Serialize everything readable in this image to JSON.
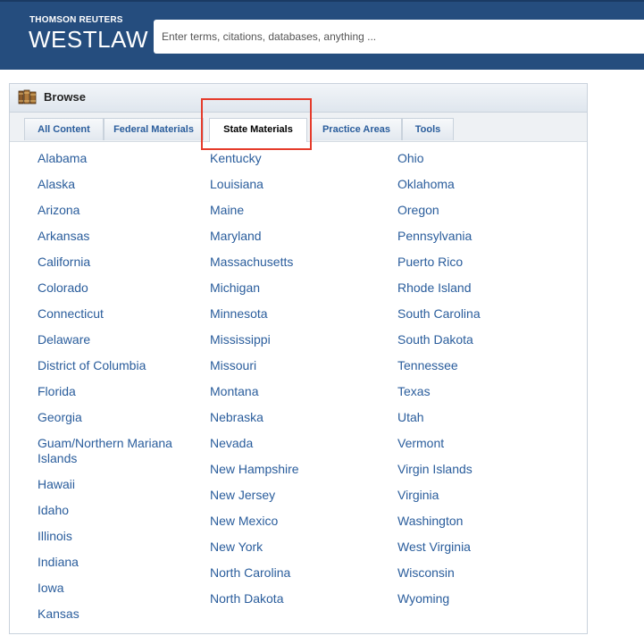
{
  "header": {
    "brand_small": "THOMSON REUTERS",
    "brand_big": "WESTLAW",
    "search_placeholder": "Enter terms, citations, databases, anything ...",
    "background_color": "#254d7e"
  },
  "browse": {
    "title": "Browse",
    "icon": "books-icon",
    "tabs": [
      {
        "label": "All Content",
        "active": false
      },
      {
        "label": "Federal Materials",
        "active": false
      },
      {
        "label": "State Materials",
        "active": true
      },
      {
        "label": "Practice Areas",
        "active": false
      },
      {
        "label": "Tools",
        "active": false
      }
    ],
    "columns": [
      [
        "Alabama",
        "Alaska",
        "Arizona",
        "Arkansas",
        "California",
        "Colorado",
        "Connecticut",
        "Delaware",
        "District of Columbia",
        "Florida",
        "Georgia",
        "Guam/Northern Mariana Islands",
        "Hawaii",
        "Idaho",
        "Illinois",
        "Indiana",
        "Iowa",
        "Kansas"
      ],
      [
        "Kentucky",
        "Louisiana",
        "Maine",
        "Maryland",
        "Massachusetts",
        "Michigan",
        "Minnesota",
        "Mississippi",
        "Missouri",
        "Montana",
        "Nebraska",
        "Nevada",
        "New Hampshire",
        "New Jersey",
        "New Mexico",
        "New York",
        "North Carolina",
        "North Dakota"
      ],
      [
        "Ohio",
        "Oklahoma",
        "Oregon",
        "Pennsylvania",
        "Puerto Rico",
        "Rhode Island",
        "South Carolina",
        "South Dakota",
        "Tennessee",
        "Texas",
        "Utah",
        "Vermont",
        "Virgin Islands",
        "Virginia",
        "Washington",
        "West Virginia",
        "Wisconsin",
        "Wyoming"
      ]
    ],
    "link_color": "#2a5d9c",
    "highlight_color": "#e53b2b"
  }
}
